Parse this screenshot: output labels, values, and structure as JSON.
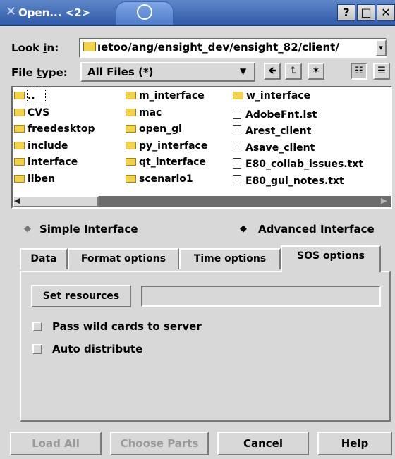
{
  "window": {
    "title": "Open... <2>",
    "help_label": "?",
    "maximize_label": "□",
    "close_label": "✕"
  },
  "lookin": {
    "label_pre": "Look ",
    "label_key": "i",
    "label_post": "n:",
    "path": "ıetoo/ang/ensight_dev/ensight_82/client/"
  },
  "filetype": {
    "label_pre": "File ",
    "label_key": "t",
    "label_post": "ype:",
    "value": "All Files (*)"
  },
  "files": [
    {
      "name": "..",
      "kind": "folder"
    },
    {
      "name": "CVS",
      "kind": "folder"
    },
    {
      "name": "freedesktop",
      "kind": "folder"
    },
    {
      "name": "include",
      "kind": "folder"
    },
    {
      "name": "interface",
      "kind": "folder"
    },
    {
      "name": "liben",
      "kind": "folder"
    },
    {
      "name": "m_interface",
      "kind": "folder"
    },
    {
      "name": "mac",
      "kind": "folder"
    },
    {
      "name": "open_gl",
      "kind": "folder"
    },
    {
      "name": "py_interface",
      "kind": "folder"
    },
    {
      "name": "qt_interface",
      "kind": "folder"
    },
    {
      "name": "scenario1",
      "kind": "folder"
    },
    {
      "name": "w_interface",
      "kind": "folder"
    },
    {
      "name": "AdobeFnt.lst",
      "kind": "file"
    },
    {
      "name": "Arest_client",
      "kind": "file"
    },
    {
      "name": "Asave_client",
      "kind": "file"
    },
    {
      "name": "E80_collab_issues.txt",
      "kind": "file"
    },
    {
      "name": "E80_gui_notes.txt",
      "kind": "file"
    }
  ],
  "mode": {
    "simple": "Simple Interface",
    "advanced": "Advanced Interface",
    "selected": "advanced"
  },
  "tabs": [
    {
      "label": "Data"
    },
    {
      "label": "Format options"
    },
    {
      "label": "Time options"
    },
    {
      "label": "SOS options"
    }
  ],
  "active_tab": "SOS options",
  "sos": {
    "set_resources": "Set resources",
    "resources_value": "",
    "pass_wild": "Pass wild cards to server",
    "auto_distribute": "Auto distribute"
  },
  "buttons": {
    "load_all": "Load All",
    "choose_parts": "Choose Parts",
    "cancel": "Cancel",
    "help": "Help"
  }
}
